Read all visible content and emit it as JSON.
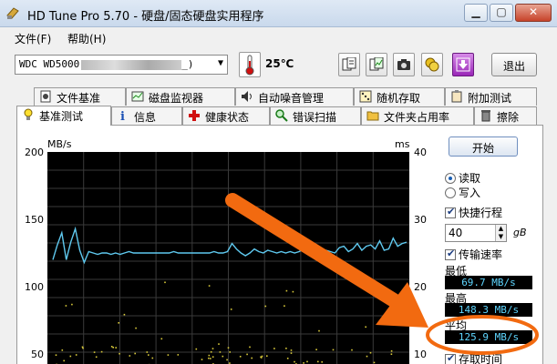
{
  "window": {
    "title": "HD Tune Pro 5.70 - 硬盘/固态硬盘实用程序"
  },
  "menu": {
    "file": "文件(F)",
    "help": "帮助(H)"
  },
  "toolbar": {
    "drive": "WDC WD5000",
    "drive_tail": "_)",
    "temperature": "25℃",
    "exit": "退出"
  },
  "tabs_top": [
    "文件基准",
    "磁盘监视器",
    "自动噪音管理",
    "随机存取",
    "附加测试"
  ],
  "tabs_bottom": [
    "基准测试",
    "信息",
    "健康状态",
    "错误扫描",
    "文件夹占用率",
    "擦除"
  ],
  "chart": {
    "left_unit": "MB/s",
    "right_unit": "ms"
  },
  "chart_data": {
    "type": "line",
    "xlabel": "",
    "ylabel": "MB/s",
    "y_ticks": [
      200,
      150,
      100,
      50
    ],
    "y2_ticks": [
      40,
      30,
      20,
      10
    ],
    "ylim": [
      0,
      200
    ],
    "y2lim": [
      0,
      40
    ],
    "grid": true,
    "series": [
      {
        "values": [
          120,
          131,
          140,
          120,
          133,
          143,
          127,
          118,
          126,
          125,
          124,
          125,
          125,
          124,
          125,
          124,
          125,
          126,
          125,
          125,
          125,
          125,
          125,
          125,
          125,
          125,
          125,
          126,
          125,
          125,
          125,
          125,
          125,
          125,
          125,
          125,
          126,
          125,
          125,
          126,
          132,
          128,
          125,
          123,
          125,
          128,
          126,
          125,
          127,
          126,
          125,
          126,
          125,
          126,
          125,
          126,
          128,
          125,
          126,
          127,
          125,
          127,
          126,
          125,
          129,
          130,
          126,
          128,
          132,
          127,
          130,
          131,
          128,
          134,
          127,
          128,
          136,
          130,
          132,
          133
        ]
      }
    ]
  },
  "controls": {
    "start": "开始",
    "read": "读取",
    "write": "写入",
    "short_stroke": "快捷行程",
    "short_value": "40",
    "unit": "gB",
    "transfer_rate": "传输速率",
    "min_label": "最低",
    "min_value": "69.7 MB/s",
    "max_label": "最高",
    "max_value": "148.3 MB/s",
    "avg_label": "平均",
    "avg_value": "125.9 MB/s",
    "access_time": "存取时间"
  },
  "colors": {
    "accent": "#f26a10",
    "chart_bg": "#000000",
    "line": "#5fc9ef",
    "scatter": "#d8c93a"
  }
}
